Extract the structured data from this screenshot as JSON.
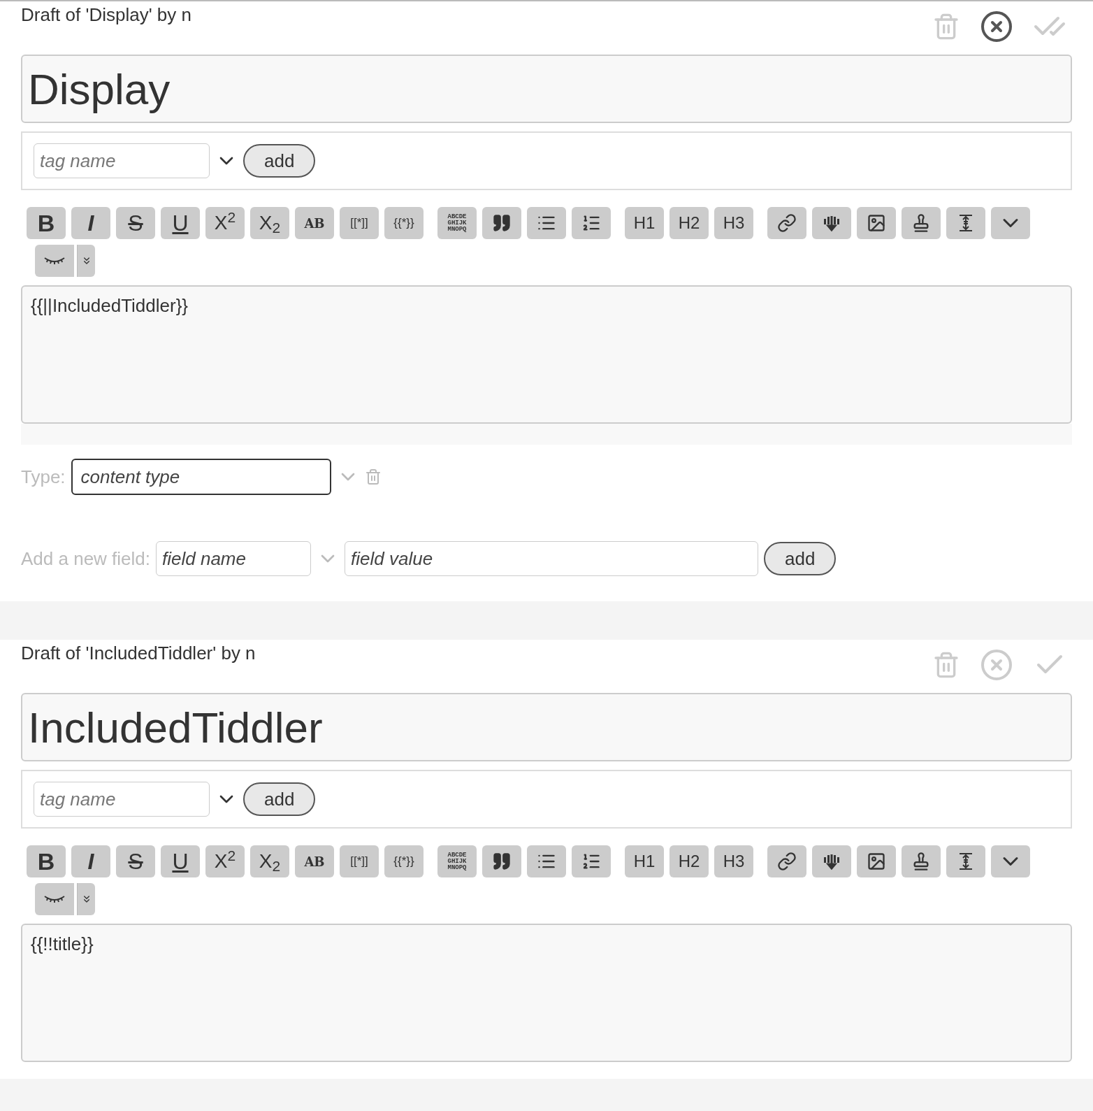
{
  "tiddlers": [
    {
      "header": "Draft of 'Display' by n",
      "cancel_highlighted": true,
      "save": {
        "kind": "double"
      },
      "title": "Display",
      "tag_placeholder": "tag name",
      "tag_add": "add",
      "toolbar": [
        [
          {
            "kind": "bold",
            "label": "B"
          },
          {
            "kind": "italic",
            "label": "I"
          },
          {
            "kind": "strike",
            "label": "S"
          },
          {
            "kind": "underline",
            "label": "U"
          },
          {
            "kind": "rich",
            "label": "X$^{2}$"
          },
          {
            "kind": "rich",
            "label": "X$_{2}$"
          },
          {
            "kind": "smallcaps",
            "label": "AB"
          },
          {
            "kind": "small",
            "label": "[[*]]"
          },
          {
            "kind": "small",
            "label": "{{*}}"
          }
        ],
        [
          {
            "kind": "mono",
            "label": "ABCDE GHIJK MNOPQ"
          },
          {
            "kind": "quote"
          },
          {
            "kind": "bullets"
          },
          {
            "kind": "numbers"
          }
        ],
        [
          {
            "kind": "plain",
            "label": "H1"
          },
          {
            "kind": "plain",
            "label": "H2"
          },
          {
            "kind": "plain",
            "label": "H3"
          }
        ],
        [
          {
            "kind": "link"
          },
          {
            "kind": "excise"
          },
          {
            "kind": "picture"
          },
          {
            "kind": "stamp"
          },
          {
            "kind": "size"
          },
          {
            "kind": "more"
          }
        ],
        [
          {
            "kind": "eye"
          },
          {
            "kind": "expand"
          }
        ]
      ],
      "text": "{{||IncludedTiddler}}",
      "type_label": "Type:",
      "type_placeholder": "content type",
      "field_label": "Add a new field:",
      "field_name_placeholder": "field name",
      "field_value_placeholder": "field value",
      "field_add": "add"
    },
    {
      "header": "Draft of 'IncludedTiddler' by n",
      "cancel_highlighted": false,
      "save": {
        "kind": "single"
      },
      "title": "IncludedTiddler",
      "tag_placeholder": "tag name",
      "tag_add": "add",
      "toolbar": [
        [
          {
            "kind": "bold",
            "label": "B"
          },
          {
            "kind": "italic",
            "label": "I"
          },
          {
            "kind": "strike",
            "label": "S"
          },
          {
            "kind": "underline",
            "label": "U"
          },
          {
            "kind": "rich",
            "label": "X$^{2}$"
          },
          {
            "kind": "rich",
            "label": "X$_{2}$"
          },
          {
            "kind": "smallcaps",
            "label": "AB"
          },
          {
            "kind": "small",
            "label": "[[*]]"
          },
          {
            "kind": "small",
            "label": "{{*}}"
          }
        ],
        [
          {
            "kind": "mono",
            "label": "ABCDE GHIJK MNOPQ"
          },
          {
            "kind": "quote"
          },
          {
            "kind": "bullets"
          },
          {
            "kind": "numbers"
          }
        ],
        [
          {
            "kind": "plain",
            "label": "H1"
          },
          {
            "kind": "plain",
            "label": "H2"
          },
          {
            "kind": "plain",
            "label": "H3"
          }
        ],
        [
          {
            "kind": "link"
          },
          {
            "kind": "excise"
          },
          {
            "kind": "picture"
          },
          {
            "kind": "stamp"
          },
          {
            "kind": "size"
          },
          {
            "kind": "more"
          }
        ],
        [
          {
            "kind": "eye"
          },
          {
            "kind": "expand"
          }
        ]
      ],
      "text": "{{!!title}}"
    }
  ]
}
